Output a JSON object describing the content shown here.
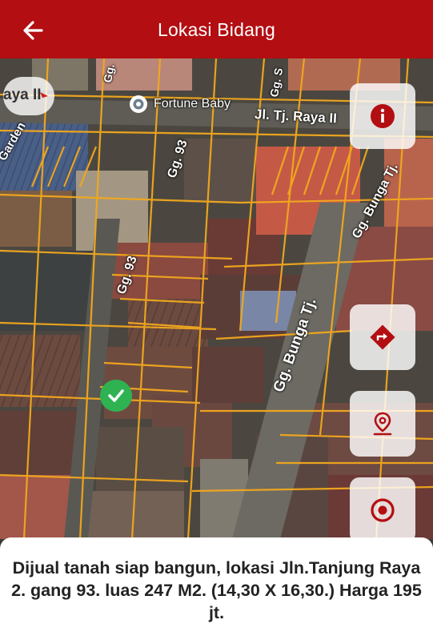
{
  "appbar": {
    "title": "Lokasi Bidang",
    "back_icon": "arrow-left-icon"
  },
  "map": {
    "poi_label": "Fortune Baby",
    "compass_text": "aya II",
    "streets": {
      "raya": "Jl. Tj. Raya II",
      "gg93_top": "Gg. 93",
      "gg93_mid": "Gg. 93",
      "bunga_main": "Gg. Bunga Tj.",
      "bunga_top": "Gg. Bunga Tj.",
      "garden": "Garden",
      "gg_top": "Gg.",
      "gg_s": "Gg. S"
    }
  },
  "buttons": {
    "info": {
      "icon": "info-icon"
    },
    "directions": {
      "icon": "directions-icon"
    },
    "location_pin": {
      "icon": "location-pin-icon"
    },
    "my_location": {
      "icon": "target-icon"
    }
  },
  "description": "Dijual tanah siap bangun, lokasi Jln.Tanjung Raya 2. gang 93. luas 247 M2. (14,30 X 16,30.) Harga 195 jt.",
  "colors": {
    "appbar": "#b30e12",
    "accent": "#b30e12",
    "parcel_line": "#f2a81d",
    "check": "#2fb352"
  }
}
